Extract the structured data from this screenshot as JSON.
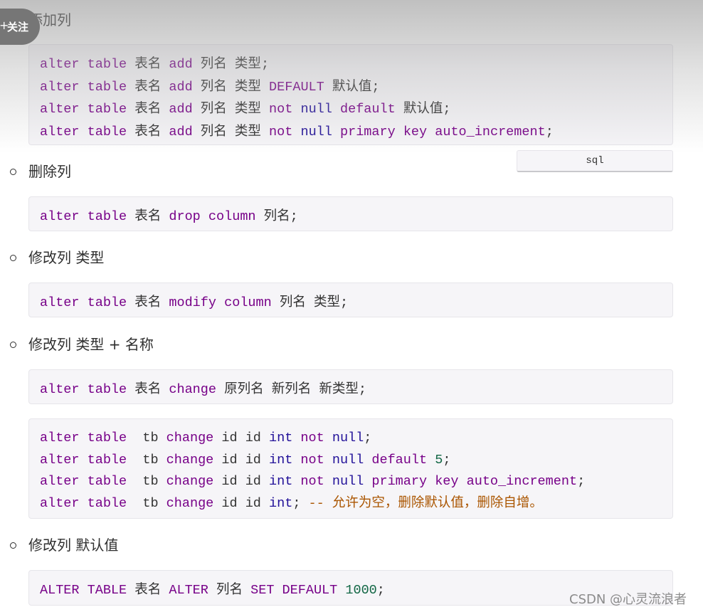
{
  "follow_button": {
    "plus": "+",
    "label": "关注"
  },
  "sections": [
    {
      "title": "添加列",
      "blocks": [
        {
          "lines": [
            [
              [
                "kw",
                "alter"
              ],
              [
                "p",
                " "
              ],
              [
                "kw",
                "table"
              ],
              [
                "p",
                " "
              ],
              [
                "cjk",
                "表名"
              ],
              [
                "p",
                " "
              ],
              [
                "kw",
                "add"
              ],
              [
                "p",
                " "
              ],
              [
                "cjk",
                "列名"
              ],
              [
                "p",
                " "
              ],
              [
                "cjk",
                "类型"
              ],
              [
                "p",
                ";"
              ]
            ],
            [
              [
                "kw",
                "alter"
              ],
              [
                "p",
                " "
              ],
              [
                "kw",
                "table"
              ],
              [
                "p",
                " "
              ],
              [
                "cjk",
                "表名"
              ],
              [
                "p",
                " "
              ],
              [
                "kw",
                "add"
              ],
              [
                "p",
                " "
              ],
              [
                "cjk",
                "列名"
              ],
              [
                "p",
                " "
              ],
              [
                "cjk",
                "类型"
              ],
              [
                "p",
                " "
              ],
              [
                "kw",
                "DEFAULT"
              ],
              [
                "p",
                " "
              ],
              [
                "cjk",
                "默认值"
              ],
              [
                "p",
                ";"
              ]
            ],
            [
              [
                "kw",
                "alter"
              ],
              [
                "p",
                " "
              ],
              [
                "kw",
                "table"
              ],
              [
                "p",
                " "
              ],
              [
                "cjk",
                "表名"
              ],
              [
                "p",
                " "
              ],
              [
                "kw",
                "add"
              ],
              [
                "p",
                " "
              ],
              [
                "cjk",
                "列名"
              ],
              [
                "p",
                " "
              ],
              [
                "cjk",
                "类型"
              ],
              [
                "p",
                " "
              ],
              [
                "kw",
                "not"
              ],
              [
                "p",
                " "
              ],
              [
                "type",
                "null"
              ],
              [
                "p",
                " "
              ],
              [
                "kw",
                "default"
              ],
              [
                "p",
                " "
              ],
              [
                "cjk",
                "默认值"
              ],
              [
                "p",
                ";"
              ]
            ],
            [
              [
                "kw",
                "alter"
              ],
              [
                "p",
                " "
              ],
              [
                "kw",
                "table"
              ],
              [
                "p",
                " "
              ],
              [
                "cjk",
                "表名"
              ],
              [
                "p",
                " "
              ],
              [
                "kw",
                "add"
              ],
              [
                "p",
                " "
              ],
              [
                "cjk",
                "列名"
              ],
              [
                "p",
                " "
              ],
              [
                "cjk",
                "类型"
              ],
              [
                "p",
                " "
              ],
              [
                "kw",
                "not"
              ],
              [
                "p",
                " "
              ],
              [
                "type",
                "null"
              ],
              [
                "p",
                " "
              ],
              [
                "kw",
                "primary"
              ],
              [
                "p",
                " "
              ],
              [
                "kw",
                "key"
              ],
              [
                "p",
                " "
              ],
              [
                "kw",
                "auto_increment"
              ],
              [
                "p",
                ";"
              ]
            ]
          ]
        }
      ]
    },
    {
      "title": "删除列",
      "blocks": [
        {
          "lines": [
            [
              [
                "kw",
                "alter"
              ],
              [
                "p",
                " "
              ],
              [
                "kw",
                "table"
              ],
              [
                "p",
                " "
              ],
              [
                "cjk",
                "表名"
              ],
              [
                "p",
                " "
              ],
              [
                "kw",
                "drop"
              ],
              [
                "p",
                " "
              ],
              [
                "kw",
                "column"
              ],
              [
                "p",
                " "
              ],
              [
                "cjk",
                "列名"
              ],
              [
                "p",
                ";"
              ]
            ]
          ]
        }
      ]
    },
    {
      "title": "修改列 类型",
      "blocks": [
        {
          "lines": [
            [
              [
                "kw",
                "alter"
              ],
              [
                "p",
                " "
              ],
              [
                "kw",
                "table"
              ],
              [
                "p",
                " "
              ],
              [
                "cjk",
                "表名"
              ],
              [
                "p",
                " "
              ],
              [
                "kw",
                "modify"
              ],
              [
                "p",
                " "
              ],
              [
                "kw",
                "column"
              ],
              [
                "p",
                " "
              ],
              [
                "cjk",
                "列名"
              ],
              [
                "p",
                " "
              ],
              [
                "cjk",
                "类型"
              ],
              [
                "p",
                ";"
              ]
            ]
          ]
        }
      ]
    },
    {
      "title": "修改列 类型 + 名称",
      "blocks": [
        {
          "lines": [
            [
              [
                "kw",
                "alter"
              ],
              [
                "p",
                " "
              ],
              [
                "kw",
                "table"
              ],
              [
                "p",
                " "
              ],
              [
                "cjk",
                "表名"
              ],
              [
                "p",
                " "
              ],
              [
                "kw",
                "change"
              ],
              [
                "p",
                " "
              ],
              [
                "cjk",
                "原列名"
              ],
              [
                "p",
                " "
              ],
              [
                "cjk",
                "新列名"
              ],
              [
                "p",
                " "
              ],
              [
                "cjk",
                "新类型"
              ],
              [
                "p",
                ";"
              ]
            ]
          ]
        },
        {
          "lines": [
            [
              [
                "kw",
                "alter"
              ],
              [
                "p",
                " "
              ],
              [
                "kw",
                "table"
              ],
              [
                "p",
                "  tb "
              ],
              [
                "kw",
                "change"
              ],
              [
                "p",
                " id id "
              ],
              [
                "type",
                "int"
              ],
              [
                "p",
                " "
              ],
              [
                "kw",
                "not"
              ],
              [
                "p",
                " "
              ],
              [
                "type",
                "null"
              ],
              [
                "p",
                ";"
              ]
            ],
            [
              [
                "kw",
                "alter"
              ],
              [
                "p",
                " "
              ],
              [
                "kw",
                "table"
              ],
              [
                "p",
                "  tb "
              ],
              [
                "kw",
                "change"
              ],
              [
                "p",
                " id id "
              ],
              [
                "type",
                "int"
              ],
              [
                "p",
                " "
              ],
              [
                "kw",
                "not"
              ],
              [
                "p",
                " "
              ],
              [
                "type",
                "null"
              ],
              [
                "p",
                " "
              ],
              [
                "kw",
                "default"
              ],
              [
                "p",
                " "
              ],
              [
                "num",
                "5"
              ],
              [
                "p",
                ";"
              ]
            ],
            [
              [
                "kw",
                "alter"
              ],
              [
                "p",
                " "
              ],
              [
                "kw",
                "table"
              ],
              [
                "p",
                "  tb "
              ],
              [
                "kw",
                "change"
              ],
              [
                "p",
                " id id "
              ],
              [
                "type",
                "int"
              ],
              [
                "p",
                " "
              ],
              [
                "kw",
                "not"
              ],
              [
                "p",
                " "
              ],
              [
                "type",
                "null"
              ],
              [
                "p",
                " "
              ],
              [
                "kw",
                "primary"
              ],
              [
                "p",
                " "
              ],
              [
                "kw",
                "key"
              ],
              [
                "p",
                " "
              ],
              [
                "kw",
                "auto_increment"
              ],
              [
                "p",
                ";"
              ]
            ],
            [
              [
                "kw",
                "alter"
              ],
              [
                "p",
                " "
              ],
              [
                "kw",
                "table"
              ],
              [
                "p",
                "  tb "
              ],
              [
                "kw",
                "change"
              ],
              [
                "p",
                " id id "
              ],
              [
                "type",
                "int"
              ],
              [
                "p",
                "; "
              ],
              [
                "comment",
                "-- 允许为空，删除默认值，删除自增。"
              ]
            ]
          ]
        }
      ]
    },
    {
      "title": "修改列 默认值",
      "blocks": [
        {
          "lines": [
            [
              [
                "kw",
                "ALTER"
              ],
              [
                "p",
                " "
              ],
              [
                "kw",
                "TABLE"
              ],
              [
                "p",
                " "
              ],
              [
                "cjk",
                "表名"
              ],
              [
                "p",
                " "
              ],
              [
                "kw",
                "ALTER"
              ],
              [
                "p",
                " "
              ],
              [
                "cjk",
                "列名"
              ],
              [
                "p",
                " "
              ],
              [
                "kw",
                "SET"
              ],
              [
                "p",
                " "
              ],
              [
                "kw",
                "DEFAULT"
              ],
              [
                "p",
                " "
              ],
              [
                "num",
                "1000"
              ],
              [
                "p",
                ";"
              ]
            ]
          ]
        }
      ]
    }
  ],
  "code_language_tab": "sql",
  "watermark": "CSDN @心灵流浪者",
  "colors": {
    "keyword": "#770088",
    "type": "#221199",
    "number": "#116644",
    "comment": "#aa5500",
    "code_bg": "#f6f5f8"
  }
}
